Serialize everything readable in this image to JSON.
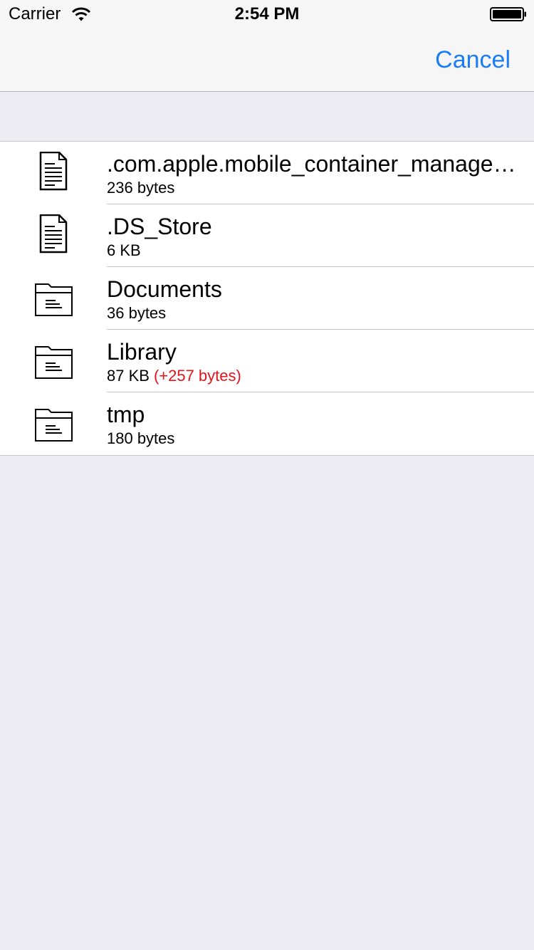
{
  "status_bar": {
    "carrier": "Carrier",
    "time": "2:54 PM"
  },
  "nav_bar": {
    "cancel_label": "Cancel"
  },
  "colors": {
    "accent": "#1a7cf6",
    "change_highlight": "#e3141b",
    "background": "#ebebf1"
  },
  "files": [
    {
      "name": ".com.apple.mobile_container_manager.metadata.plist",
      "size": "236 bytes",
      "change": "",
      "icon": "document-icon"
    },
    {
      "name": ".DS_Store",
      "size": "6 KB",
      "change": "",
      "icon": "document-icon"
    },
    {
      "name": "Documents",
      "size": "36 bytes",
      "change": "",
      "icon": "folder-icon"
    },
    {
      "name": "Library",
      "size": "87 KB",
      "change": "(+257 bytes)",
      "icon": "folder-icon"
    },
    {
      "name": "tmp",
      "size": "180 bytes",
      "change": "",
      "icon": "folder-icon"
    }
  ]
}
